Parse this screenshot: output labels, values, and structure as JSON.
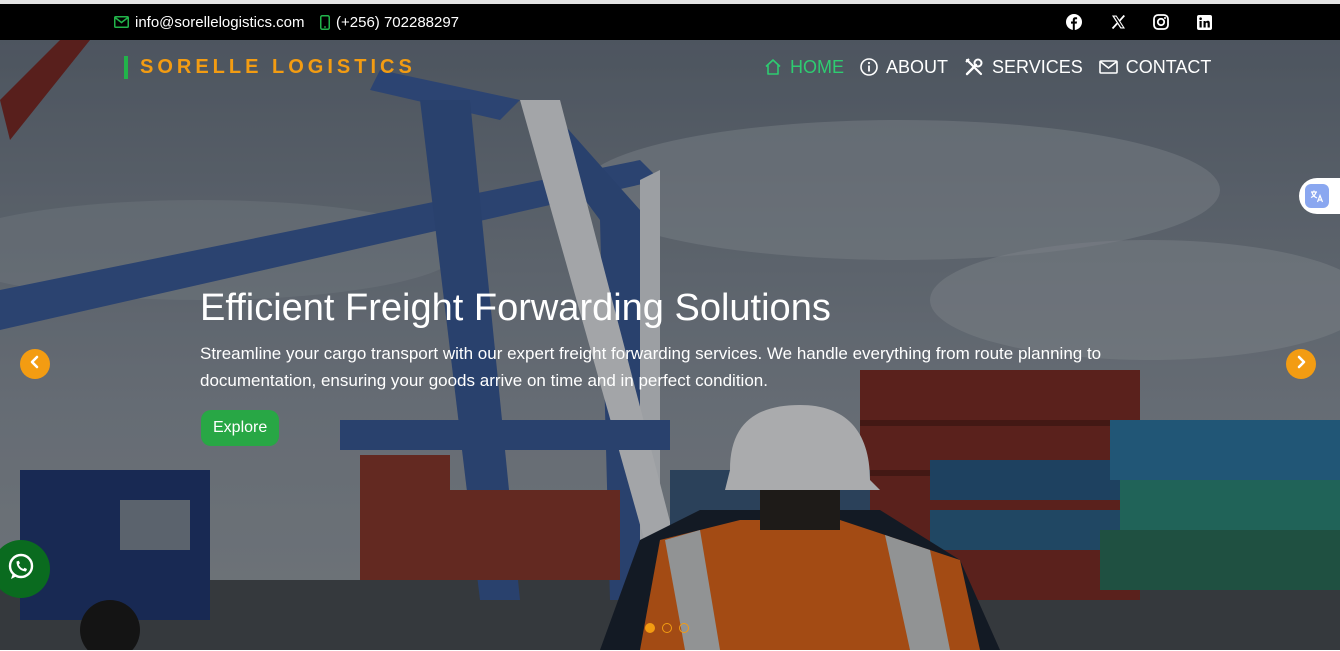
{
  "topbar": {
    "email": "info@sorellelogistics.com",
    "phone": "(+256) 702288297",
    "social": [
      "facebook-icon",
      "x-icon",
      "instagram-icon",
      "linkedin-icon"
    ]
  },
  "brand": {
    "name": "SORELLE LOGISTICS"
  },
  "nav": {
    "items": [
      {
        "label": "HOME",
        "icon": "home-icon",
        "active": true
      },
      {
        "label": "ABOUT",
        "icon": "info-icon",
        "active": false
      },
      {
        "label": "SERVICES",
        "icon": "tools-icon",
        "active": false
      },
      {
        "label": "CONTACT",
        "icon": "envelope-icon",
        "active": false
      }
    ]
  },
  "hero": {
    "title": "Efficient Freight Forwarding Solutions",
    "description": "Streamline your cargo transport with our expert freight forwarding services. We handle everything from route planning to documentation, ensuring your goods arrive on time and in perfect condition.",
    "cta_label": "Explore",
    "slide_count": 3,
    "active_slide": 1
  },
  "widgets": {
    "translate_icon": "translate-icon",
    "whatsapp_icon": "whatsapp-icon"
  },
  "colors": {
    "accent": "#f39c12",
    "green": "#28a745",
    "nav_active": "#2ecc71",
    "topbar_bg": "#000000"
  }
}
